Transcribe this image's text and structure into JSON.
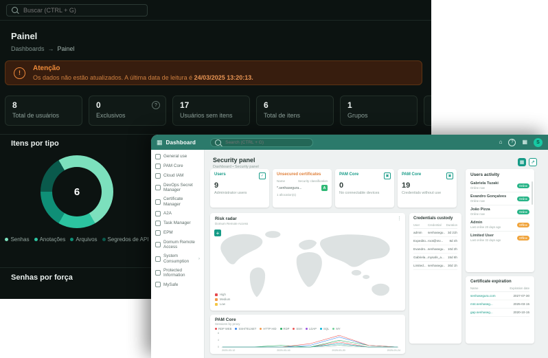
{
  "dark_app": {
    "search_placeholder": "Buscar (CTRL + G)",
    "page_title": "Painel",
    "breadcrumb": {
      "root": "Dashboards",
      "sep": "→",
      "current": "Painel"
    },
    "alert": {
      "icon_glyph": "!",
      "title": "Atenção",
      "message": "Os dados não estão atualizados. A última data de leitura é",
      "date": "24/03/2025 13:20:13."
    },
    "help_glyph": "?",
    "stats": [
      {
        "value": "8",
        "label": "Total de usuários"
      },
      {
        "value": "0",
        "label": "Exclusivos"
      },
      {
        "value": "17",
        "label": "Usuários sem itens"
      },
      {
        "value": "6",
        "label": "Total de itens"
      },
      {
        "value": "1",
        "label": "Grupos"
      }
    ],
    "sections": {
      "items_by_type": "Itens por tipo",
      "passwords_by_strength": "Senhas por força"
    },
    "donut_total": "6"
  },
  "overlay": {
    "header": {
      "title": "Dashboard",
      "search_placeholder": "Search (CTRL + G)",
      "logo_glyph": "▦",
      "home_glyph": "⌂",
      "help_glyph": "?",
      "apps_glyph": "▦",
      "avatar_initial": "S"
    },
    "sidebar": {
      "chevron": "›",
      "items": [
        {
          "label": "General use"
        },
        {
          "label": "PAM Core"
        },
        {
          "label": "Cloud IAM"
        },
        {
          "label": "DevOps Secret Manager"
        },
        {
          "label": "Certificate Manager"
        },
        {
          "label": "A2A"
        },
        {
          "label": "Task Manager"
        },
        {
          "label": "EPM"
        },
        {
          "label": "Domum Remote Access"
        },
        {
          "label": "System Consumption"
        },
        {
          "label": "Protected Information"
        },
        {
          "label": "MySafe"
        }
      ]
    },
    "page": {
      "title": "Security panel",
      "breadcrumb": "Dashboard  •  Security panel",
      "grid_glyph": "▦",
      "expand_glyph": "⇗"
    },
    "kpis": {
      "users": {
        "category": "Users",
        "value": "9",
        "label": "Administrator users",
        "icon_glyph": "✓"
      },
      "certificates": {
        "category": "Unsecured certificates",
        "col_name": "Name",
        "col_class": "Security classification",
        "row_name": "*.senhasegura...",
        "grade": "A",
        "footer": "1 allocation(s)"
      },
      "devices": {
        "category": "PAM Core",
        "value": "0",
        "label": "No connectable devices",
        "icon_glyph": "▣"
      },
      "credentials": {
        "category": "PAM Core",
        "value": "19",
        "label": "Credentials without use",
        "icon_glyph": "▣"
      }
    },
    "users_activity": {
      "title": "Users activity",
      "users": [
        {
          "name": "Gabriela Tuzaki",
          "sub": "Online now",
          "status": "Online"
        },
        {
          "name": "Evandro Gonçalves",
          "sub": "Online now",
          "status": "Online"
        },
        {
          "name": "João Pizza",
          "sub": "Online now",
          "status": "Online"
        },
        {
          "name": "Admin",
          "sub": "Last online 20 days ago",
          "status": "Offline"
        },
        {
          "name": "Limited User",
          "sub": "Last online 32 days ago",
          "status": "Offline"
        }
      ]
    },
    "risk_radar": {
      "title": "Risk radar",
      "subtitle": "Domum Remote Access",
      "zoom_in": "+",
      "menu_glyph": "⋮",
      "legend": [
        {
          "label": "High",
          "color": "#e5484d"
        },
        {
          "label": "Medium",
          "color": "#f2994a"
        },
        {
          "label": "Low",
          "color": "#f4c542"
        }
      ]
    },
    "credentials_custody": {
      "title": "Credentials custody",
      "columns": [
        "User",
        "Credential",
        "Duration"
      ],
      "rows": [
        [
          "admin",
          "senhasegu...",
          "3d 21h"
        ],
        [
          "Expedito...",
          "root@srv...",
          "8d 4h"
        ],
        [
          "Evandro...",
          "senhasegu...",
          "10d 2h"
        ],
        [
          "Gabriela...",
          "mysafe_a...",
          "15d 6h"
        ],
        [
          "Limited...",
          "senhasegu...",
          "30d 1h"
        ]
      ]
    },
    "certificate_expiration": {
      "title": "Certificate expiration",
      "columns": [
        "Name",
        "Expiration date"
      ],
      "rows": [
        [
          "senhasegura.com",
          "2027-07-30"
        ],
        [
          "mt4.senhaseg...",
          "2025-03-15"
        ],
        [
          "gap.senhaseg...",
          "2020-10-15"
        ]
      ]
    },
    "pam_chart": {
      "title": "PAM Core",
      "subtitle": "Sessions by proxy"
    }
  },
  "chart_data": [
    {
      "type": "pie",
      "variant": "donut",
      "title": "Itens por tipo",
      "total": 6,
      "segments": [
        {
          "label": "Senhas",
          "value": 3,
          "color": "#7ce0bd"
        },
        {
          "label": "Anotações",
          "value": 1,
          "color": "#2cc3a0"
        },
        {
          "label": "Arquivos",
          "value": 1,
          "color": "#0f8f77"
        },
        {
          "label": "Segredos de API",
          "value": 1,
          "color": "#0a5a4c"
        }
      ],
      "legend_position": "bottom"
    },
    {
      "type": "line",
      "title": "PAM Core",
      "subtitle": "Sessions by proxy",
      "x": [
        "03-12",
        "03-14",
        "03-16",
        "03-18",
        "03-20",
        "03-22",
        "03-24"
      ],
      "x_ticks": [
        "2025-03-12",
        "2025-03-16",
        "2025-03-20",
        "2025-03-24"
      ],
      "ylim": [
        0,
        8
      ],
      "y_ticks": [
        "8",
        "4",
        "0"
      ],
      "legend_position": "top",
      "series": [
        {
          "name": "RDP WEB",
          "color": "#e5484d",
          "values": [
            0,
            0,
            0,
            0,
            3,
            0,
            0
          ]
        },
        {
          "name": "SSH/TELNET",
          "color": "#2f80ed",
          "values": [
            0,
            0,
            0,
            1,
            6,
            1,
            0
          ]
        },
        {
          "name": "HTTP HID",
          "color": "#f2994a",
          "values": [
            0,
            0,
            0,
            0,
            2,
            0,
            0
          ]
        },
        {
          "name": "RDP",
          "color": "#27ae60",
          "values": [
            0,
            0,
            1,
            0,
            4,
            1,
            0
          ]
        },
        {
          "name": "SSH",
          "color": "#eb5757",
          "values": [
            0,
            0,
            0,
            2,
            7,
            1,
            0
          ]
        },
        {
          "name": "LDAP",
          "color": "#9b51e0",
          "values": [
            0,
            0,
            0,
            0,
            1,
            0,
            0
          ]
        },
        {
          "name": "SQL",
          "color": "#00b5d8",
          "values": [
            0,
            0,
            0,
            0,
            2,
            0,
            0
          ]
        },
        {
          "name": "MY",
          "color": "#6fcf97",
          "values": [
            0,
            0,
            0,
            0,
            1,
            0,
            0
          ]
        }
      ]
    }
  ]
}
